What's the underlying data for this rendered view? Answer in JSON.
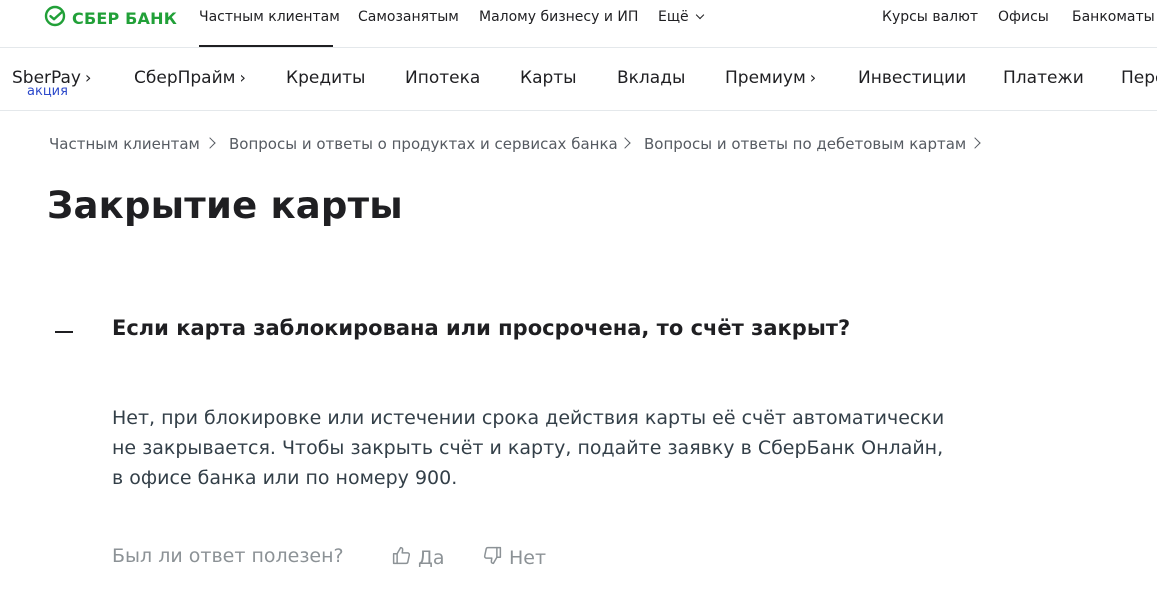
{
  "brand": {
    "name": "СБЕР БАНК",
    "logo_icon": "sber-logo-icon",
    "color": "#21a038"
  },
  "segments": [
    {
      "label": "Частным клиентам",
      "active": true
    },
    {
      "label": "Самозанятым"
    },
    {
      "label": "Малому бизнесу и ИП"
    },
    {
      "label": "Ещё"
    }
  ],
  "top_links": [
    "Курсы валют",
    "Офисы",
    "Банкоматы"
  ],
  "main_nav": [
    {
      "label": "SberPay",
      "arrow": "›",
      "badge": "акция"
    },
    {
      "label": "СберПрайм",
      "arrow": "›"
    },
    {
      "label": "Кредиты"
    },
    {
      "label": "Ипотека"
    },
    {
      "label": "Карты"
    },
    {
      "label": "Вклады"
    },
    {
      "label": "Премиум",
      "arrow": "›"
    },
    {
      "label": "Инвестиции"
    },
    {
      "label": "Платежи"
    },
    {
      "label": "Пере"
    }
  ],
  "breadcrumbs": [
    "Частным клиентам",
    "Вопросы и ответы о продуктах и сервисах банка",
    "Вопросы и ответы по дебетовым картам"
  ],
  "page_title": "Закрытие карты",
  "faq": {
    "question": "Если карта заблокирована или просрочена, то счёт закрыт?",
    "answer_lines": [
      "Нет, при блокировке или истечении срока действия карты её счёт автоматически",
      "не закрывается. Чтобы закрыть счёт и карту, подайте заявку в СберБанк Онлайн,",
      "в офисе банка или по номеру 900."
    ],
    "feedback_question": "Был ли ответ полезен?",
    "yes_label": "Да",
    "no_label": "Нет"
  }
}
